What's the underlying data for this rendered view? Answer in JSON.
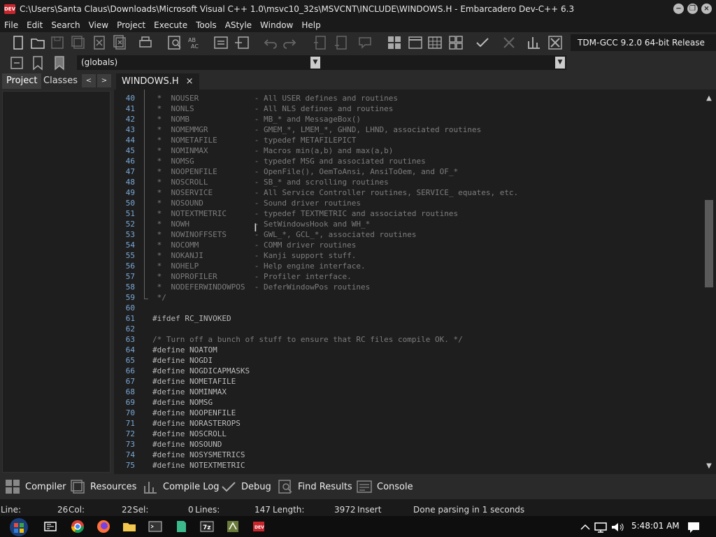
{
  "window": {
    "title": "C:\\Users\\Santa Claus\\Downloads\\Microsoft Visual C++ 1.0\\msvc10_32s\\MSVCNT\\INCLUDE\\WINDOWS.H - Embarcadero Dev-C++ 6.3",
    "app_icon_text": "DEV C++",
    "minimize": "−",
    "restore": "❐",
    "close": "×"
  },
  "menu": {
    "items": [
      "File",
      "Edit",
      "Search",
      "View",
      "Project",
      "Execute",
      "Tools",
      "AStyle",
      "Window",
      "Help"
    ]
  },
  "toolbar": {
    "compiler": "TDM-GCC 9.2.0 64-bit Release",
    "class_combo": "(globals)",
    "member_combo": ""
  },
  "left_panel": {
    "tabs": [
      "Project",
      "Classes"
    ],
    "active_tab": "Project",
    "prev": "<",
    "next": ">"
  },
  "editor": {
    "tab_label": "WINDOWS.H",
    "tab_close": "×",
    "lines": [
      {
        "n": "40",
        "text": " *  NOUSER            - All USER defines and routines",
        "kind": "comment"
      },
      {
        "n": "41",
        "text": " *  NONLS             - All NLS defines and routines",
        "kind": "comment"
      },
      {
        "n": "42",
        "text": " *  NOMB              - MB_* and MessageBox()",
        "kind": "comment"
      },
      {
        "n": "43",
        "text": " *  NOMEMMGR          - GMEM_*, LMEM_*, GHND, LHND, associated routines",
        "kind": "comment"
      },
      {
        "n": "44",
        "text": " *  NOMETAFILE        - typedef METAFILEPICT",
        "kind": "comment"
      },
      {
        "n": "45",
        "text": " *  NOMINMAX          - Macros min(a,b) and max(a,b)",
        "kind": "comment"
      },
      {
        "n": "46",
        "text": " *  NOMSG             - typedef MSG and associated routines",
        "kind": "comment"
      },
      {
        "n": "47",
        "text": " *  NOOPENFILE        - OpenFile(), OemToAnsi, AnsiToOem, and OF_*",
        "kind": "comment"
      },
      {
        "n": "48",
        "text": " *  NOSCROLL          - SB_* and scrolling routines",
        "kind": "comment"
      },
      {
        "n": "49",
        "text": " *  NOSERVICE         - All Service Controller routines, SERVICE_ equates, etc.",
        "kind": "comment"
      },
      {
        "n": "50",
        "text": " *  NOSOUND           - Sound driver routines",
        "kind": "comment"
      },
      {
        "n": "51",
        "text": " *  NOTEXTMETRIC      - typedef TEXTMETRIC and associated routines",
        "kind": "comment"
      },
      {
        "n": "52",
        "text": " *  NOWH              - SetWindowsHook and WH_*",
        "kind": "comment"
      },
      {
        "n": "53",
        "text": " *  NOWINOFFSETS      - GWL_*, GCL_*, associated routines",
        "kind": "comment"
      },
      {
        "n": "54",
        "text": " *  NOCOMM            - COMM driver routines",
        "kind": "comment"
      },
      {
        "n": "55",
        "text": " *  NOKANJI           - Kanji support stuff.",
        "kind": "comment"
      },
      {
        "n": "56",
        "text": " *  NOHELP            - Help engine interface.",
        "kind": "comment"
      },
      {
        "n": "57",
        "text": " *  NOPROFILER        - Profiler interface.",
        "kind": "comment"
      },
      {
        "n": "58",
        "text": " *  NODEFERWINDOWPOS  - DeferWindowPos routines",
        "kind": "comment"
      },
      {
        "n": "59",
        "text": " */",
        "kind": "comment"
      },
      {
        "n": "60",
        "text": "",
        "kind": "code"
      },
      {
        "n": "61",
        "text": "#ifdef RC_INVOKED",
        "kind": "define"
      },
      {
        "n": "62",
        "text": "",
        "kind": "code"
      },
      {
        "n": "63",
        "text": "/* Turn off a bunch of stuff to ensure that RC files compile OK. */",
        "kind": "comment"
      },
      {
        "n": "64",
        "text": "#define NOATOM",
        "kind": "define"
      },
      {
        "n": "65",
        "text": "#define NOGDI",
        "kind": "define"
      },
      {
        "n": "66",
        "text": "#define NOGDICAPMASKS",
        "kind": "define"
      },
      {
        "n": "67",
        "text": "#define NOMETAFILE",
        "kind": "define"
      },
      {
        "n": "68",
        "text": "#define NOMINMAX",
        "kind": "define"
      },
      {
        "n": "69",
        "text": "#define NOMSG",
        "kind": "define"
      },
      {
        "n": "70",
        "text": "#define NOOPENFILE",
        "kind": "define"
      },
      {
        "n": "71",
        "text": "#define NORASTEROPS",
        "kind": "define"
      },
      {
        "n": "72",
        "text": "#define NOSCROLL",
        "kind": "define"
      },
      {
        "n": "73",
        "text": "#define NOSOUND",
        "kind": "define"
      },
      {
        "n": "74",
        "text": "#define NOSYSMETRICS",
        "kind": "define"
      },
      {
        "n": "75",
        "text": "#define NOTEXTMETRIC",
        "kind": "define"
      }
    ]
  },
  "bottom_tabs": [
    "Compiler",
    "Resources",
    "Compile Log",
    "Debug",
    "Find Results",
    "Console"
  ],
  "status": {
    "line_label": "Line:",
    "line_value": "26",
    "col_label": "Col:",
    "col_value": "22",
    "sel_label": "Sel:",
    "sel_value": "0",
    "lines_label": "Lines:",
    "lines_value": "147",
    "length_label": "Length:",
    "length_value": "3972",
    "mode": "Insert",
    "message": "Done parsing in 1 seconds"
  },
  "taskbar": {
    "clock": "5:48:01 AM",
    "icons": [
      "task-view-icon",
      "chrome-icon",
      "firefox-icon",
      "file-explorer-icon",
      "cmd-icon",
      "notepad-icon",
      "7zip-icon",
      "app-icon",
      "devcpp-icon"
    ],
    "tray": [
      "chevron-up-icon",
      "network-icon",
      "volume-icon",
      "notification-icon"
    ]
  },
  "colors": {
    "line_number": "#7aa8d6",
    "comment": "#7d7d7d",
    "code": "#bcbcbc",
    "background": "#1e1e1e"
  }
}
